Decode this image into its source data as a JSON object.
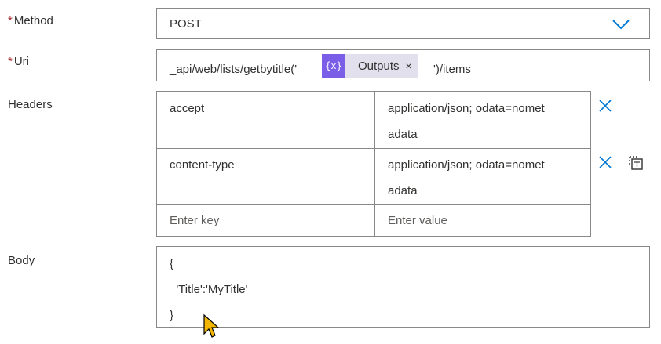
{
  "method": {
    "label": "Method",
    "required_mark": "*",
    "value": "POST",
    "chevron_icon": "chevron-down-icon"
  },
  "uri": {
    "label": "Uri",
    "required_mark": "*",
    "prefix": "_api/web/lists/getbytitle('",
    "token": {
      "icon": "expression-icon",
      "icon_glyph": "{x}",
      "label": "Outputs",
      "close": "×"
    },
    "suffix": "')/items"
  },
  "headers": {
    "label": "Headers",
    "rows": [
      {
        "key": "accept",
        "value_line1": "application/json; odata=nomet",
        "value_line2": "adata"
      },
      {
        "key": "content-type",
        "value_line1": "application/json; odata=nomet",
        "value_line2": "adata"
      }
    ],
    "new_row": {
      "key_placeholder": "Enter key",
      "value_placeholder": "Enter value"
    }
  },
  "body": {
    "label": "Body",
    "lines": [
      "{",
      "  'Title':'MyTitle'",
      "}"
    ]
  },
  "colors": {
    "accent": "#0078d4",
    "required": "#a4262c",
    "token_bg": "#e3e0ee",
    "token_icon_bg": "#7a5ee8",
    "border": "#8a8886"
  }
}
